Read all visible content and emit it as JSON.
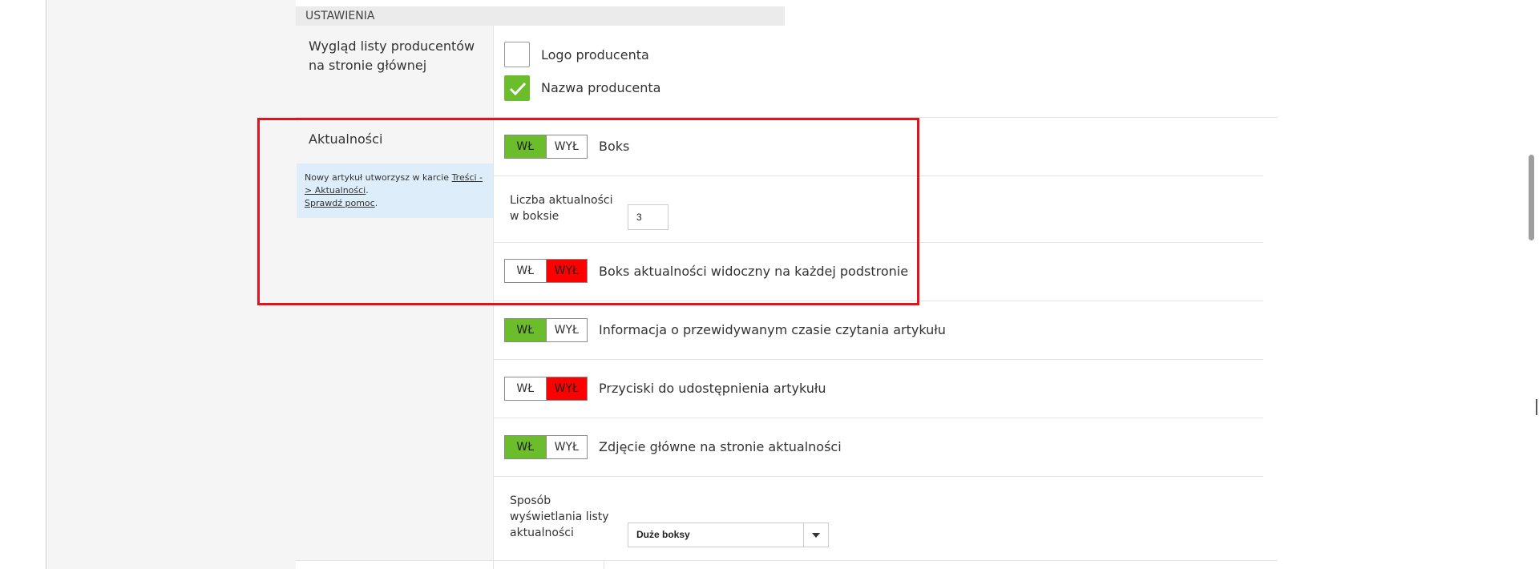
{
  "section": {
    "title": "USTAWIENIA"
  },
  "manufacturers": {
    "label": "Wygląd listy producentów na stronie głównej",
    "options": [
      {
        "label": "Logo producenta",
        "checked": false
      },
      {
        "label": "Nazwa producenta",
        "checked": true
      }
    ]
  },
  "news": {
    "label": "Aktualności",
    "info": {
      "text_before": "Nowy artykuł utworzysz w karcie ",
      "link1": "Treści -> Aktualności",
      "text_after": ".",
      "link2": "Sprawdź pomoc",
      "end": "."
    },
    "toggle_on_label": "WŁ",
    "toggle_off_label": "WYŁ",
    "toggles": [
      {
        "label": "Boks",
        "state": "on"
      },
      {
        "label": "Boks aktualności widoczny na każdej podstronie",
        "state": "off"
      },
      {
        "label": "Informacja o przewidywanym czasie czytania artykułu",
        "state": "on"
      },
      {
        "label": "Przyciski do udostępnienia artykułu",
        "state": "off"
      },
      {
        "label": "Zdjęcie główne na stronie aktualności",
        "state": "on"
      }
    ],
    "count_field": {
      "label_line1": "Liczba aktualności",
      "label_line2": "w boksie",
      "value": "3"
    },
    "display_field": {
      "label_line1": "Sposób",
      "label_line2": "wyświetlania listy",
      "label_line3": "aktualności",
      "selected": "Duże boksy"
    }
  },
  "colors": {
    "on": "#6cbd2c",
    "off": "#ff0000",
    "highlight": "#e3121c",
    "info_bg": "#ddeefa"
  },
  "icons": {
    "check": "check-icon",
    "dropdown": "chevron-down-icon"
  }
}
